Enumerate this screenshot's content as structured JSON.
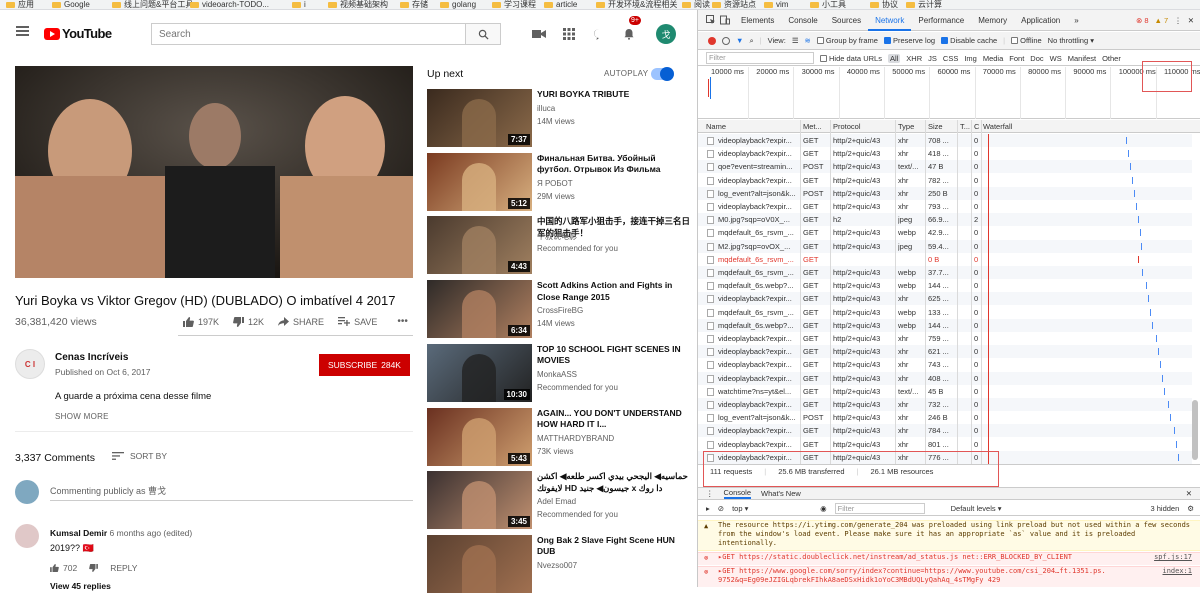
{
  "bookmarks": [
    "应用",
    "Google",
    "线上问题&平台工具",
    "videoarch-TODO...",
    "i",
    "视频基础架构",
    "存储",
    "golang",
    "学习课程",
    "article",
    "开发环境&流程相关",
    "阅读",
    "资源站点",
    "vim",
    "小工具",
    "协议",
    "云计算"
  ],
  "header": {
    "search_placeholder": "Search",
    "notif_badge": "9+",
    "avatar_letter": "戈",
    "logo_text": "YouTube"
  },
  "video": {
    "title": "Yuri Boyka vs Viktor Gregov (HD) (DUBLADO) O imbatível 4 2017",
    "views": "36,381,420 views",
    "likes": "197K",
    "dislikes": "12K",
    "share": "SHARE",
    "save": "SAVE",
    "more": "•••"
  },
  "channel": {
    "name": "Cenas Incríveis",
    "published": "Published on Oct 6, 2017",
    "subscribe": "SUBSCRIBE",
    "subs": "284K",
    "description": "A guarde a próxima cena desse filme",
    "show_more": "SHOW MORE",
    "avatar_text": "C I"
  },
  "comments": {
    "count": "3,337 Comments",
    "sort": "SORT BY",
    "placeholder": "Commenting publicly as 曹戈",
    "author": "Kumsal Demir",
    "meta": "6 months ago (edited)",
    "text": "2019??",
    "flag": "🇹🇷",
    "likes": "702",
    "reply": "REPLY",
    "view_replies": "View 45 replies"
  },
  "upnext": {
    "heading": "Up next",
    "autoplay": "AUTOPLAY"
  },
  "recommendations": [
    {
      "title": "YURI BOYKA TRIBUTE",
      "channel": "illuca",
      "views": "14M views",
      "duration": "7:37",
      "colors": [
        "#3a2a1e",
        "#8b6a4a"
      ]
    },
    {
      "title": "Финальная Битва. Убойный футбол. Отрывок Из Фильма",
      "channel": "Я РОБОТ",
      "views": "29M views",
      "duration": "5:12",
      "colors": [
        "#7a3a20",
        "#d8b080"
      ]
    },
    {
      "title": "中国的八路军小狙击手，接连干掉三名日军的狙击手！",
      "channel": "牛叔说电影",
      "views": "Recommended for you",
      "duration": "4:43",
      "colors": [
        "#4a3a2e",
        "#a08060"
      ]
    },
    {
      "title": "Scott Adkins Action and Fights in Close Range 2015",
      "channel": "CrossFireBG",
      "views": "14M views",
      "duration": "6:34",
      "colors": [
        "#2e2a28",
        "#b08060"
      ]
    },
    {
      "title": "TOP 10 SCHOOL FIGHT SCENES IN MOVIES",
      "channel": "MonkaASS",
      "views": "Recommended for you",
      "duration": "10:30",
      "colors": [
        "#5a6a7a",
        "#222222"
      ]
    },
    {
      "title": "AGAIN... YOU DON'T UNDERSTAND HOW HARD IT I...",
      "channel": "MATTHARDYBRAND",
      "views": "73K views",
      "duration": "5:43",
      "colors": [
        "#6a3020",
        "#d0a070"
      ]
    },
    {
      "title": "حماسيه◀ اليجحي بيدي اكسر طلعه◀ اكشن لايفوتك HD جيسون◀ جنيد x دا روك",
      "channel": "Adel Emad",
      "views": "Recommended for you",
      "duration": "3:45",
      "colors": [
        "#3a3030",
        "#c09070"
      ]
    },
    {
      "title": "Ong Bak 2 Slave Fight Scene HUN DUB",
      "channel": "Nvezso007",
      "views": "",
      "duration": "",
      "colors": [
        "#5a4030",
        "#a07050"
      ]
    }
  ],
  "devtools": {
    "tabs": [
      "Elements",
      "Console",
      "Sources",
      "Network",
      "Performance",
      "Memory",
      "Application",
      "»"
    ],
    "error_count": "8",
    "warn_count": "7",
    "toolbar": {
      "view": "View:",
      "group": "Group by frame",
      "preserve": "Preserve log",
      "disable": "Disable cache",
      "offline": "Offline",
      "throttle": "No throttling"
    },
    "filter": {
      "placeholder": "Filter",
      "hide": "Hide data URLs",
      "types": [
        "All",
        "XHR",
        "JS",
        "CSS",
        "Img",
        "Media",
        "Font",
        "Doc",
        "WS",
        "Manifest",
        "Other"
      ]
    },
    "ticks": [
      "10000 ms",
      "20000 ms",
      "30000 ms",
      "40000 ms",
      "50000 ms",
      "60000 ms",
      "70000 ms",
      "80000 ms",
      "90000 ms",
      "100000 ms",
      "110000 ms"
    ],
    "columns": [
      "Name",
      "Met...",
      "Protocol",
      "Type",
      "Size",
      "T...",
      "C",
      "Waterfall"
    ],
    "rows": [
      [
        "videoplayback?expir...",
        "GET",
        "http/2+quic/43",
        "xhr",
        "708 ...",
        "0"
      ],
      [
        "videoplayback?expir...",
        "GET",
        "http/2+quic/43",
        "xhr",
        "418 ...",
        "0"
      ],
      [
        "qoe?event=streamin...",
        "POST",
        "http/2+quic/43",
        "text/...",
        "47 B",
        "0"
      ],
      [
        "videoplayback?expir...",
        "GET",
        "http/2+quic/43",
        "xhr",
        "782 ...",
        "0"
      ],
      [
        "log_event?alt=json&k...",
        "POST",
        "http/2+quic/43",
        "xhr",
        "250 B",
        "0"
      ],
      [
        "videoplayback?expir...",
        "GET",
        "http/2+quic/43",
        "xhr",
        "793 ...",
        "0"
      ],
      [
        "M0.jpg?sqp=oV0X_...",
        "GET",
        "h2",
        "jpeg",
        "66.9...",
        "2"
      ],
      [
        "mqdefault_6s_rsvm_...",
        "GET",
        "http/2+quic/43",
        "webp",
        "42.9...",
        "0"
      ],
      [
        "M2.jpg?sqp=ovOX_...",
        "GET",
        "http/2+quic/43",
        "jpeg",
        "59.4...",
        "0"
      ],
      [
        "mqdefault_6s_rsvm_...",
        "GET",
        "",
        "",
        "0 B",
        "0"
      ],
      [
        "mqdefault_6s_rsvm_...",
        "GET",
        "http/2+quic/43",
        "webp",
        "37.7...",
        "0"
      ],
      [
        "mqdefault_6s.webp?...",
        "GET",
        "http/2+quic/43",
        "webp",
        "144 ...",
        "0"
      ],
      [
        "videoplayback?expir...",
        "GET",
        "http/2+quic/43",
        "xhr",
        "625 ...",
        "0"
      ],
      [
        "mqdefault_6s_rsvm_...",
        "GET",
        "http/2+quic/43",
        "webp",
        "133 ...",
        "0"
      ],
      [
        "mqdefault_6s.webp?...",
        "GET",
        "http/2+quic/43",
        "webp",
        "144 ...",
        "0"
      ],
      [
        "videoplayback?expir...",
        "GET",
        "http/2+quic/43",
        "xhr",
        "759 ...",
        "0"
      ],
      [
        "videoplayback?expir...",
        "GET",
        "http/2+quic/43",
        "xhr",
        "621 ...",
        "0"
      ],
      [
        "videoplayback?expir...",
        "GET",
        "http/2+quic/43",
        "xhr",
        "743 ...",
        "0"
      ],
      [
        "videoplayback?expir...",
        "GET",
        "http/2+quic/43",
        "xhr",
        "408 ...",
        "0"
      ],
      [
        "watchtime?ns=yt&el...",
        "GET",
        "http/2+quic/43",
        "text/...",
        "45 B",
        "0"
      ],
      [
        "videoplayback?expir...",
        "GET",
        "http/2+quic/43",
        "xhr",
        "732 ...",
        "0"
      ],
      [
        "log_event?alt=json&k...",
        "POST",
        "http/2+quic/43",
        "xhr",
        "246 B",
        "0"
      ],
      [
        "videoplayback?expir...",
        "GET",
        "http/2+quic/43",
        "xhr",
        "784 ...",
        "0"
      ],
      [
        "videoplayback?expir...",
        "GET",
        "http/2+quic/43",
        "xhr",
        "801 ...",
        "0"
      ],
      [
        "videoplayback?expir...",
        "GET",
        "http/2+quic/43",
        "xhr",
        "776 ...",
        "0"
      ]
    ],
    "status": {
      "requests": "111 requests",
      "transferred": "25.6 MB transferred",
      "resources": "26.1 MB resources"
    },
    "console": {
      "tabs": [
        "Console",
        "What's New"
      ],
      "context": "top",
      "filter": "Filter",
      "levels": "Default levels ▾",
      "hidden": "3 hidden"
    },
    "messages": [
      {
        "kind": "warn",
        "text": "The resource https://i.ytimg.com/generate_204 was preloaded using link preload but not used within a few seconds from the window's load event. Please make sure it has an appropriate `as` value and it is preloaded intentionally.",
        "src": ""
      },
      {
        "kind": "error",
        "text": "▸GET https://static.doubleclick.net/instream/ad_status.js net::ERR_BLOCKED_BY_CLIENT",
        "src": "spf.js:17"
      },
      {
        "kind": "error",
        "text": "▸GET https://www.google.com/sorry/index?continue=https://www.youtube.com/csi_204…ft.1351.ps. 9752&q=Eg09eJZIGLqbrekFIhkA8aeDSxHidk1oYoC3MBdUQLyQahAq_4sTMgFy 429",
        "src": "index:1"
      }
    ]
  }
}
